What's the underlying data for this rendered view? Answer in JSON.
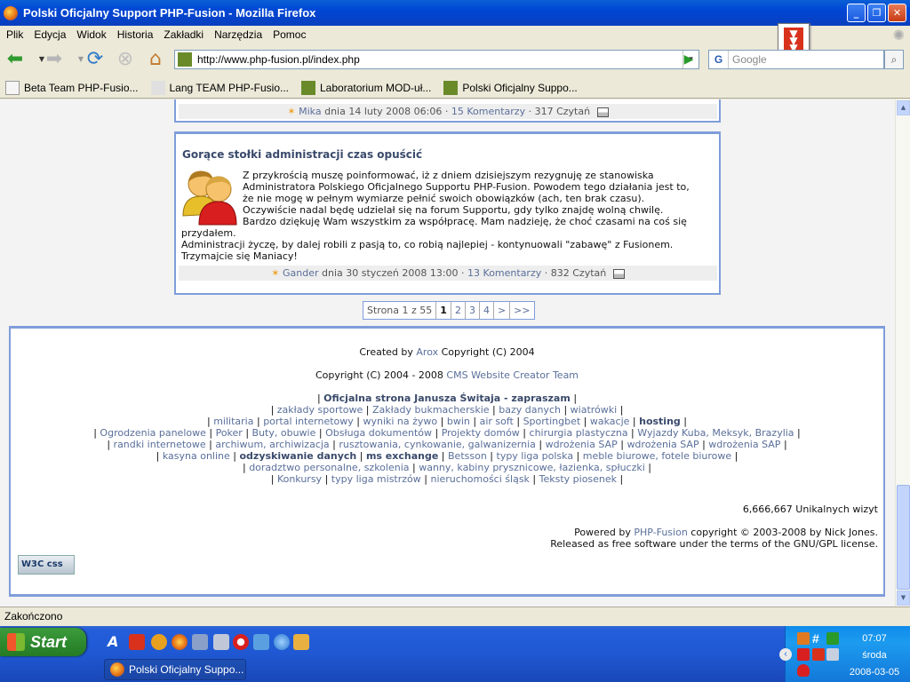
{
  "window": {
    "title": "Polski Oficjalny Support PHP-Fusion - Mozilla Firefox"
  },
  "menu": [
    "Plik",
    "Edycja",
    "Widok",
    "Historia",
    "Zakładki",
    "Narzędzia",
    "Pomoc"
  ],
  "navbar": {
    "url": "http://www.php-fusion.pl/index.php",
    "search_placeholder": "Google"
  },
  "bookmarks": [
    {
      "label": "Beta Team PHP-Fusio...",
      "color": "#f5f5f5"
    },
    {
      "label": "Lang TEAM PHP-Fusio...",
      "color": "#e0e0e0"
    },
    {
      "label": "Laboratorium MOD-uł...",
      "color": "#6a8a2a"
    },
    {
      "label": "Polski Oficjalny Suppo...",
      "color": "#6a8a2a"
    }
  ],
  "prev_news": {
    "footer_author": "Mika",
    "footer_date": "dnia 14 luty 2008 06:06",
    "footer_comments": "15 Komentarzy",
    "footer_reads": "317 Czytań"
  },
  "news": {
    "title": "Gorące stołki administracji czas opuścić",
    "body": [
      "Z przykrością muszę poinformować, iż z dniem dzisiejszym rezygnuję ze stanowiska",
      "Administratora Polskiego Oficjalnego Supportu PHP-Fusion. Powodem tego działania jest to,",
      "że nie mogę w pełnym wymiarze pełnić swoich obowiązków (ach, ten brak czasu).",
      "Oczywiście nadal będę udzielał się na forum Supportu, gdy tylko znajdę wolną chwilę.",
      "Bardzo dziękuję Wam wszystkim za współpracę. Mam nadzieję, że choć czasami na coś się"
    ],
    "body_full": [
      "przydałem.",
      "Administracji życzę, by dalej robili z pasją to, co robią najlepiej - kontynuowali \"zabawę\" z Fusionem.",
      "Trzymajcie się Maniacy!"
    ],
    "footer_author": "Gander",
    "footer_date": "dnia 30 styczeń 2008 13:00",
    "footer_comments": "13 Komentarzy",
    "footer_reads": "832 Czytań"
  },
  "pager": {
    "label": "Strona 1 z 55",
    "pages": [
      "1",
      "2",
      "3",
      "4",
      ">",
      ">>"
    ]
  },
  "footer": {
    "created_prefix": "Created by",
    "created_link": "Arox",
    "created_suffix": "Copyright (C) 2004",
    "copy_prefix": "Copyright (C) 2004 - 2008",
    "copy_link": "CMS Website Creator Team",
    "ad_line1": "Oficjalna strona Janusza Świtaja - zapraszam",
    "ad_line2": [
      "zakłady sportowe",
      "Zakłady bukmacherskie",
      "bazy danych",
      "wiatrówki"
    ],
    "ad_line3": [
      "militaria",
      "portal internetowy",
      "wyniki na żywo",
      "bwin",
      "air soft",
      "Sportingbet",
      "wakacje",
      "hosting"
    ],
    "ad_line4": [
      "Ogrodzenia panelowe",
      "Poker",
      "Buty, obuwie",
      "Obsługa dokumentów",
      "Projekty domów",
      "chirurgia plastyczna",
      "Wyjazdy Kuba, Meksyk, Brazylia"
    ],
    "ad_line5": [
      "randki internetowe",
      "archiwum, archiwizacja",
      "rusztowania, cynkowanie, galwanizernia",
      "wdrożenia SAP",
      "wdrożenia SAP",
      "wdrożenia SAP"
    ],
    "ad_line6": [
      "kasyna online",
      "odzyskiwanie danych",
      "ms exchange",
      "Betsson",
      "typy liga polska",
      "meble biurowe, fotele biurowe"
    ],
    "ad_line7": [
      "doradztwo personalne, szkolenia",
      "wanny, kabiny prysznicowe, łazienka, spłuczki"
    ],
    "ad_line8": [
      "Konkursy",
      "typy liga mistrzów",
      "nieruchomości śląsk",
      "Teksty piosenek"
    ],
    "visits": "6,666,667 Unikalnych wizyt",
    "powered_prefix": "Powered by",
    "powered_link": "PHP-Fusion",
    "powered_suffix": "copyright © 2003-2008 by Nick Jones.",
    "license": "Released as free software under the terms of the GNU/GPL license.",
    "w3c": "W3C css"
  },
  "status": "Zakończono",
  "taskbar": {
    "start": "Start",
    "task": "Polski Oficjalny Suppo...",
    "time": "07:07",
    "day": "środa",
    "date": "2008-03-05"
  }
}
